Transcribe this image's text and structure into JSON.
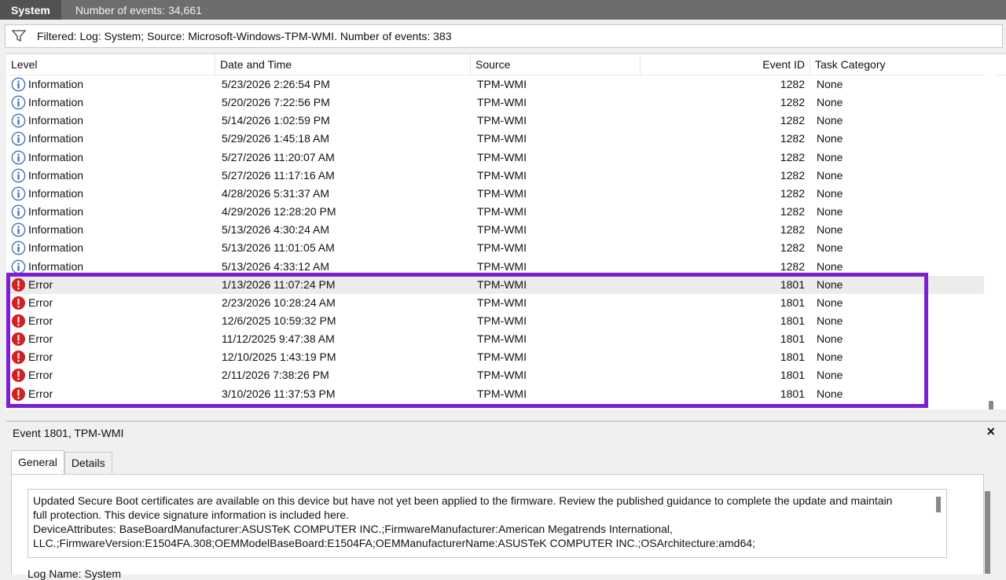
{
  "topbar": {
    "log_name": "System",
    "event_count": "Number of events: 34,661"
  },
  "filter": {
    "text": "Filtered: Log: System; Source: Microsoft-Windows-TPM-WMI. Number of events: 383"
  },
  "columns": {
    "level": "Level",
    "date": "Date and Time",
    "source": "Source",
    "event_id": "Event ID",
    "task": "Task Category"
  },
  "events": [
    {
      "level": "Information",
      "date": "5/23/2026 2:26:54 PM",
      "source": "TPM-WMI",
      "id": "1282",
      "task": "None"
    },
    {
      "level": "Information",
      "date": "5/20/2026 7:22:56 PM",
      "source": "TPM-WMI",
      "id": "1282",
      "task": "None"
    },
    {
      "level": "Information",
      "date": "5/14/2026 1:02:59 PM",
      "source": "TPM-WMI",
      "id": "1282",
      "task": "None"
    },
    {
      "level": "Information",
      "date": "5/29/2026 1:45:18 AM",
      "source": "TPM-WMI",
      "id": "1282",
      "task": "None"
    },
    {
      "level": "Information",
      "date": "5/27/2026 11:20:07 AM",
      "source": "TPM-WMI",
      "id": "1282",
      "task": "None"
    },
    {
      "level": "Information",
      "date": "5/27/2026 11:17:16 AM",
      "source": "TPM-WMI",
      "id": "1282",
      "task": "None"
    },
    {
      "level": "Information",
      "date": "4/28/2026 5:31:37 AM",
      "source": "TPM-WMI",
      "id": "1282",
      "task": "None"
    },
    {
      "level": "Information",
      "date": "4/29/2026 12:28:20 PM",
      "source": "TPM-WMI",
      "id": "1282",
      "task": "None"
    },
    {
      "level": "Information",
      "date": "5/13/2026 4:30:24 AM",
      "source": "TPM-WMI",
      "id": "1282",
      "task": "None"
    },
    {
      "level": "Information",
      "date": "5/13/2026 11:01:05 AM",
      "source": "TPM-WMI",
      "id": "1282",
      "task": "None"
    },
    {
      "level": "Information",
      "date": "5/13/2026 4:33:12 AM",
      "source": "TPM-WMI",
      "id": "1282",
      "task": "None"
    },
    {
      "level": "Error",
      "date": "1/13/2026 11:07:24 PM",
      "source": "TPM-WMI",
      "id": "1801",
      "task": "None",
      "selected": true
    },
    {
      "level": "Error",
      "date": "2/23/2026 10:28:24 AM",
      "source": "TPM-WMI",
      "id": "1801",
      "task": "None"
    },
    {
      "level": "Error",
      "date": "12/6/2025 10:59:32 PM",
      "source": "TPM-WMI",
      "id": "1801",
      "task": "None"
    },
    {
      "level": "Error",
      "date": "11/12/2025 9:47:38 AM",
      "source": "TPM-WMI",
      "id": "1801",
      "task": "None"
    },
    {
      "level": "Error",
      "date": "12/10/2025 1:43:19 PM",
      "source": "TPM-WMI",
      "id": "1801",
      "task": "None"
    },
    {
      "level": "Error",
      "date": "2/11/2026 7:38:26 PM",
      "source": "TPM-WMI",
      "id": "1801",
      "task": "None"
    },
    {
      "level": "Error",
      "date": "3/10/2026 11:37:53 PM",
      "source": "TPM-WMI",
      "id": "1801",
      "task": "None"
    }
  ],
  "detail": {
    "title": "Event 1801, TPM-WMI",
    "close": "×",
    "tabs": [
      "General",
      "Details"
    ],
    "message_lines": [
      "Updated Secure Boot certificates are available on this device but have not yet been applied to the firmware. Review the published guidance to complete the update and maintain",
      "full protection. This device signature information is included here.",
      "DeviceAttributes: BaseBoardManufacturer:ASUSTeK COMPUTER INC.;FirmwareManufacturer:American Megatrends International,",
      "LLC.;FirmwareVersion:E1504FA.308;OEMModelBaseBoard:E1504FA;OEMManufacturerName:ASUSTeK COMPUTER INC.;OSArchitecture:amd64;"
    ],
    "cut_text": "Log Name:          System"
  },
  "colors": {
    "info_icon": "#3b6fb6",
    "error_icon": "#d32020",
    "highlight": "#7c1fd1"
  },
  "icons": {
    "info": "information-icon",
    "error": "error-icon",
    "filter": "funnel-icon"
  }
}
